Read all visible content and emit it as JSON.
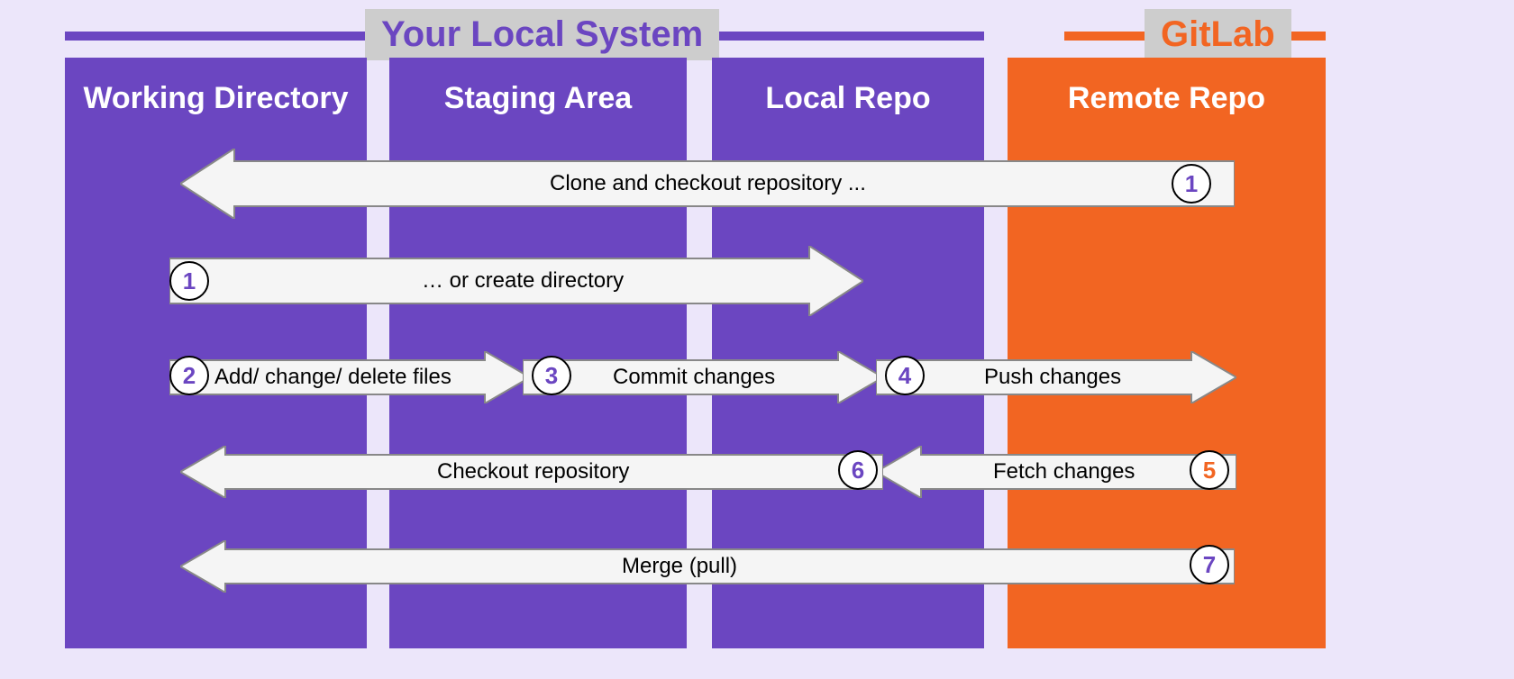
{
  "header": {
    "local_label": "Your Local System",
    "remote_label": "GitLab"
  },
  "columns": {
    "working_dir": "Working Directory",
    "staging": "Staging Area",
    "local_repo": "Local Repo",
    "remote_repo": "Remote Repo"
  },
  "arrows": {
    "clone": {
      "num": "1",
      "label": "Clone and checkout repository ..."
    },
    "create_dir": {
      "num": "1",
      "label": "… or create directory"
    },
    "add_files": {
      "num": "2",
      "label": "Add/ change/ delete files"
    },
    "commit": {
      "num": "3",
      "label": "Commit changes"
    },
    "push": {
      "num": "4",
      "label": "Push changes"
    },
    "fetch": {
      "num": "5",
      "label": "Fetch changes"
    },
    "checkout": {
      "num": "6",
      "label": "Checkout repository"
    },
    "merge": {
      "num": "7",
      "label": "Merge (pull)"
    }
  }
}
